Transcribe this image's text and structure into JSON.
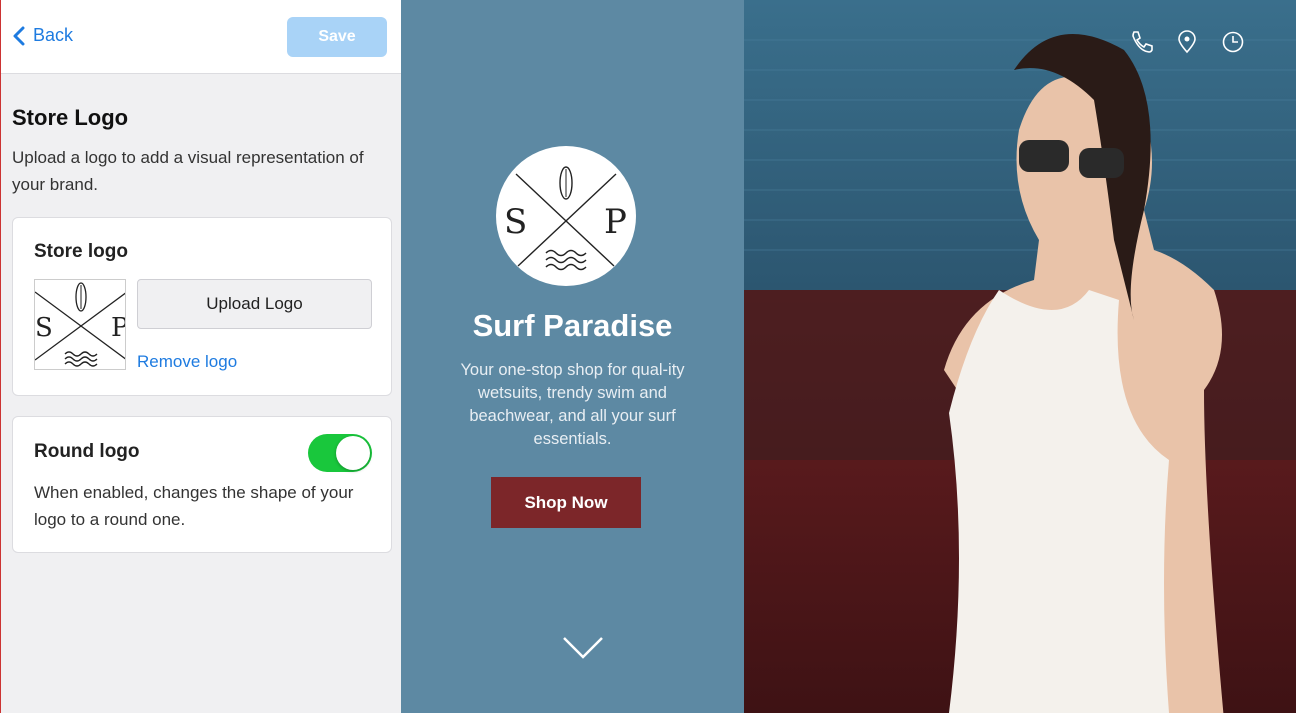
{
  "header": {
    "back_label": "Back",
    "save_label": "Save"
  },
  "section": {
    "title": "Store Logo",
    "description": "Upload a logo to add a visual representation of your brand."
  },
  "logo_card": {
    "label": "Store logo",
    "upload_label": "Upload Logo",
    "remove_label": "Remove logo",
    "logo_letters": [
      "S",
      "P"
    ]
  },
  "round_card": {
    "label": "Round logo",
    "toggle_on": true,
    "description": "When enabled, changes the shape of your logo to a round one."
  },
  "preview": {
    "store_name": "Surf Paradise",
    "description": "Your one-stop shop for qual-ity wetsuits, trendy swim and beachwear, and all your surf essentials.",
    "cta_label": "Shop Now",
    "scroll_icon": "chevron-down-icon"
  },
  "photo_icons": [
    "phone-icon",
    "location-pin-icon",
    "clock-icon"
  ],
  "colors": {
    "accent": "#1e7be0",
    "save_disabled": "#a9d3f7",
    "toggle_on": "#19c73c",
    "preview_bg": "#5d89a3",
    "cta_bg": "#7c2629"
  }
}
